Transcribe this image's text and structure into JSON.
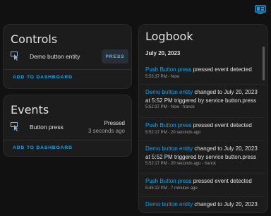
{
  "controls": {
    "title": "Controls",
    "entity_name": "Demo button entity",
    "press_label": "PRESS",
    "add_label": "ADD TO DASHBOARD"
  },
  "events": {
    "title": "Events",
    "entity_name": "Button press",
    "state": "Pressed",
    "time": "3 seconds ago",
    "add_label": "ADD TO DASHBOARD"
  },
  "logbook": {
    "title": "Logbook",
    "date": "July 20, 2023",
    "entries": [
      {
        "link": "Push Button press",
        "text": " pressed event detected",
        "meta": "5:53:37 PM - Now"
      },
      {
        "link": "Demo button entity",
        "text": " changed to July 20, 2023 at 5:52 PM triggered by service button.press",
        "meta": "5:52:37 PM - Now - franck"
      },
      {
        "link": "Push Button press",
        "text": " pressed event detected",
        "meta": "5:52:17 PM - 20 seconds ago"
      },
      {
        "link": "Demo button entity",
        "text": " changed to July 20, 2023 at 5:52 PM triggered by service button.press",
        "meta": "5:52:17 PM - 20 seconds ago - franck"
      },
      {
        "link": "Push Button press",
        "text": " pressed event detected",
        "meta": "5:45:12 PM - 7 minutes ago"
      },
      {
        "link": "Demo button entity",
        "text": " changed to July 20, 2023",
        "meta": ""
      }
    ]
  },
  "icons": {
    "header": "dashboard-monitor-icon",
    "controls_row": "button-pointer-icon",
    "events_row": "button-pointer-icon"
  },
  "colors": {
    "accent": "#03a9f4",
    "background": "#111111",
    "card": "#1c1c1c"
  }
}
